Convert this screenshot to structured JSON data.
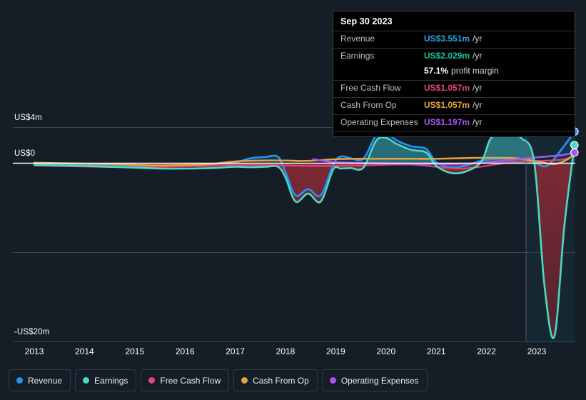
{
  "chart_data": {
    "type": "line",
    "title": "",
    "xlabel": "",
    "ylabel": "",
    "currency": "US$",
    "units": "millions",
    "grid": true,
    "legend_position": "bottom",
    "x_tick_labels": [
      "2013",
      "2014",
      "2015",
      "2016",
      "2017",
      "2018",
      "2019",
      "2020",
      "2021",
      "2022",
      "2023"
    ],
    "y_tick_labels": [
      "US$4m",
      "US$0",
      "-US$20m"
    ],
    "y_axis_top_label": "US$4m",
    "y_axis_zero_label": "US$0",
    "y_axis_bottom_label": "-US$20m",
    "ylim": [
      -20,
      4
    ],
    "xlim": [
      2013,
      2023.85
    ],
    "zero_line": 0,
    "highlight_region_start": "2022.8",
    "series": [
      {
        "name": "Revenue",
        "color": "#2196f3",
        "x": [
          2013.0,
          2013.5,
          2014.0,
          2014.5,
          2015.0,
          2015.5,
          2016.0,
          2016.5,
          2017.0,
          2017.3,
          2017.6,
          2017.85,
          2018.0,
          2018.2,
          2018.45,
          2018.7,
          2018.95,
          2019.1,
          2019.3,
          2019.55,
          2019.8,
          2020.0,
          2020.2,
          2020.5,
          2020.8,
          2021.0,
          2021.3,
          2021.6,
          2021.9,
          2022.1,
          2022.4,
          2022.7,
          2022.95,
          2023.2,
          2023.5,
          2023.75
        ],
        "values": [
          -0.1,
          -0.12,
          -0.15,
          -0.2,
          -0.25,
          -0.3,
          -0.3,
          -0.28,
          0.1,
          0.55,
          0.7,
          0.72,
          -1.0,
          -3.6,
          -2.9,
          -3.6,
          -0.15,
          0.75,
          0.55,
          0.5,
          3.1,
          3.45,
          2.6,
          1.9,
          1.6,
          0.1,
          -0.45,
          -0.25,
          0.3,
          0.45,
          0.5,
          0.45,
          0.1,
          -0.3,
          1.6,
          3.551
        ]
      },
      {
        "name": "Earnings",
        "color": "#4dd9c0",
        "x": [
          2013.0,
          2013.5,
          2014.0,
          2014.5,
          2015.0,
          2015.5,
          2016.0,
          2016.5,
          2017.0,
          2017.3,
          2017.6,
          2017.85,
          2018.0,
          2018.2,
          2018.45,
          2018.7,
          2018.95,
          2019.1,
          2019.3,
          2019.55,
          2019.8,
          2020.0,
          2020.2,
          2020.5,
          2020.8,
          2021.0,
          2021.3,
          2021.6,
          2021.9,
          2022.1,
          2022.4,
          2022.7,
          2022.95,
          2023.15,
          2023.35,
          2023.55,
          2023.75
        ],
        "values": [
          -0.2,
          -0.25,
          -0.3,
          -0.4,
          -0.5,
          -0.6,
          -0.6,
          -0.55,
          -0.4,
          -0.45,
          -0.4,
          -0.4,
          -1.6,
          -4.3,
          -3.4,
          -4.3,
          -0.7,
          -0.6,
          -0.55,
          -0.5,
          2.5,
          2.85,
          2.2,
          1.5,
          1.2,
          -0.3,
          -1.1,
          -0.9,
          0.2,
          2.9,
          3.3,
          2.8,
          0.1,
          -13.5,
          -19.4,
          -7.0,
          2.029
        ]
      },
      {
        "name": "Free Cash Flow",
        "color": "#e0447c",
        "x": [
          2013.0,
          2015.0,
          2017.0,
          2018.5,
          2019.5,
          2020.5,
          2021.5,
          2022.5,
          2023.5,
          2023.75
        ],
        "values": [
          -0.25,
          -0.45,
          -0.2,
          -0.3,
          -0.25,
          -0.15,
          -0.6,
          0.1,
          0.4,
          1.057
        ]
      },
      {
        "name": "Cash From Op",
        "color": "#e8a33d",
        "x": [
          2013.0,
          2013.5,
          2014.0,
          2014.5,
          2015.0,
          2015.5,
          2016.0,
          2016.5,
          2017.0,
          2017.5,
          2018.0,
          2018.3,
          2018.6,
          2019.0,
          2019.4,
          2019.8,
          2020.2,
          2020.6,
          2021.0,
          2021.4,
          2021.8,
          2022.2,
          2022.6,
          2023.0,
          2023.35,
          2023.6,
          2023.75
        ],
        "values": [
          0.05,
          0.0,
          -0.05,
          -0.1,
          -0.2,
          -0.25,
          -0.2,
          -0.1,
          0.2,
          0.3,
          0.3,
          0.25,
          0.3,
          0.45,
          0.5,
          0.5,
          0.5,
          0.5,
          0.5,
          0.55,
          0.6,
          0.6,
          0.55,
          0.2,
          -0.1,
          0.4,
          1.057
        ]
      },
      {
        "name": "Operating Expenses",
        "color": "#a855f7",
        "x": [
          2018.55,
          2018.9,
          2019.3,
          2019.8,
          2020.4,
          2021.0,
          2021.6,
          2022.2,
          2022.8,
          2023.2,
          2023.5,
          2023.75
        ],
        "values": [
          0.45,
          0.15,
          0.05,
          0.0,
          -0.05,
          -0.1,
          -0.05,
          0.2,
          0.55,
          0.75,
          0.9,
          1.197
        ]
      }
    ],
    "endpoint_markers": [
      {
        "series": "Revenue",
        "color": "#2196f3",
        "value": 3.551
      },
      {
        "series": "Earnings",
        "color": "#4dd9c0",
        "value": 2.029
      },
      {
        "series": "Operating Expenses",
        "color": "#a855f7",
        "value": 1.197
      }
    ]
  },
  "tooltip": {
    "date": "Sep 30 2023",
    "rows": [
      {
        "label": "Revenue",
        "value": "US$3.551m",
        "suffix": "/yr",
        "color": "#2b9fe3"
      },
      {
        "label": "Earnings",
        "value": "US$2.029m",
        "suffix": "/yr",
        "color": "#18c29a"
      }
    ],
    "margin": {
      "percent": "57.1%",
      "text": "profit margin"
    },
    "rows2": [
      {
        "label": "Free Cash Flow",
        "value": "US$1.057m",
        "suffix": "/yr",
        "color": "#e0447c"
      },
      {
        "label": "Cash From Op",
        "value": "US$1.057m",
        "suffix": "/yr",
        "color": "#e8a33d"
      },
      {
        "label": "Operating Expenses",
        "value": "US$1.197m",
        "suffix": "/yr",
        "color": "#a855f7"
      }
    ]
  },
  "legend": {
    "items": [
      {
        "label": "Revenue",
        "color": "#2196f3"
      },
      {
        "label": "Earnings",
        "color": "#4dd9c0"
      },
      {
        "label": "Free Cash Flow",
        "color": "#e0447c"
      },
      {
        "label": "Cash From Op",
        "color": "#e8a33d"
      },
      {
        "label": "Operating Expenses",
        "color": "#a855f7"
      }
    ]
  },
  "colors": {
    "background": "#151d27",
    "gridline": "#3b434f",
    "zero_line": "#ffffff",
    "negative_fill": "#7a2430",
    "positive_fill": "#2a6b74"
  }
}
